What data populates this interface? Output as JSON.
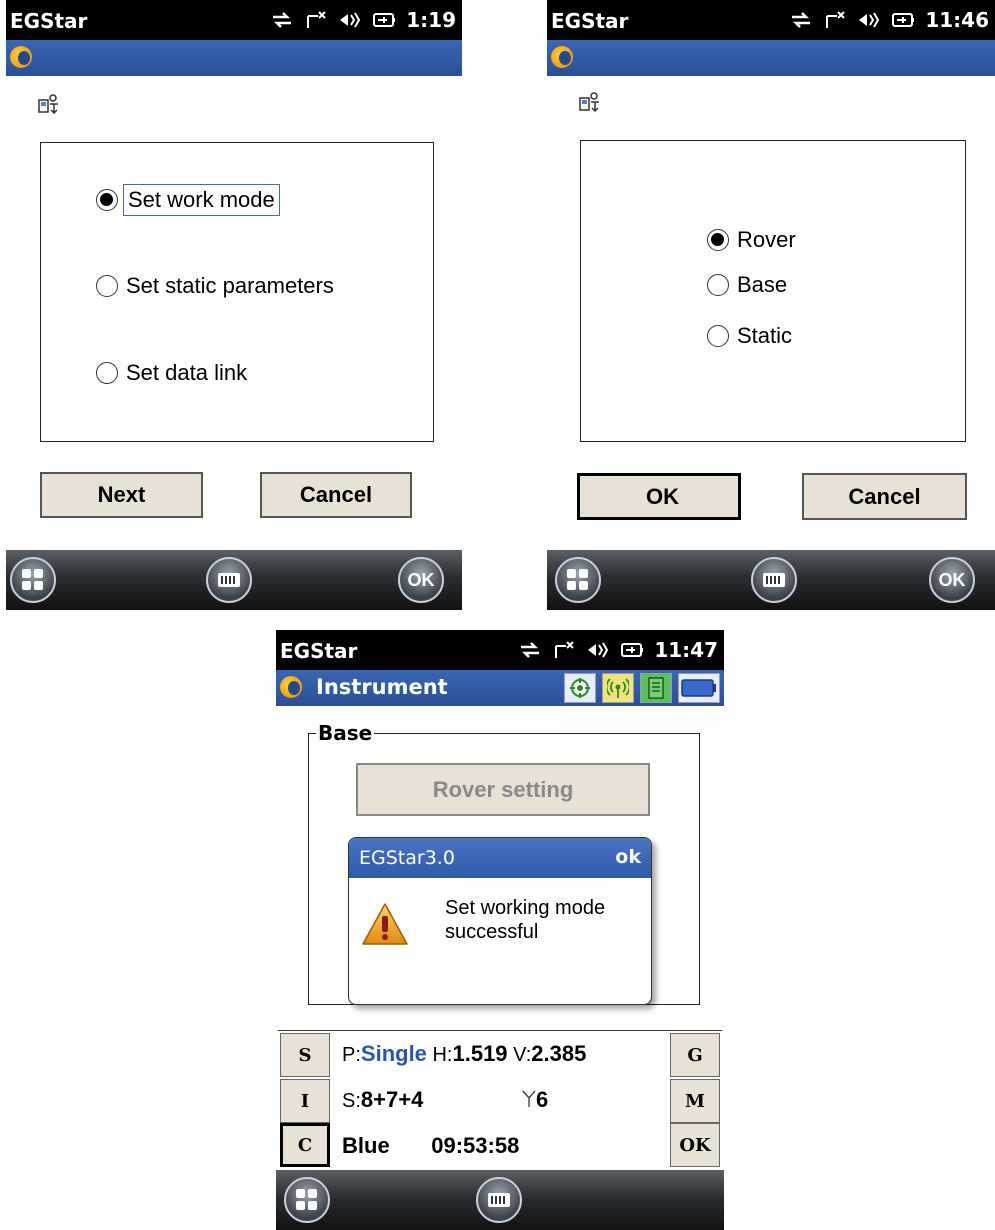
{
  "status": {
    "app": "EGStar",
    "times": [
      "1:19",
      "11:46",
      "11:47"
    ]
  },
  "screen1": {
    "options": [
      {
        "label": "Set work mode",
        "selected": true
      },
      {
        "label": "Set static parameters",
        "selected": false
      },
      {
        "label": "Set data link",
        "selected": false
      }
    ],
    "next_label": "Next",
    "cancel_label": "Cancel",
    "taskbar_ok": "OK"
  },
  "screen2": {
    "options": [
      {
        "label": "Rover",
        "selected": true
      },
      {
        "label": "Base",
        "selected": false
      },
      {
        "label": "Static",
        "selected": false
      }
    ],
    "ok_label": "OK",
    "cancel_label": "Cancel",
    "taskbar_ok": "OK"
  },
  "screen3": {
    "title": "Instrument",
    "group_label": "Base",
    "rover_setting_label": "Rover setting",
    "dialog": {
      "title": "EGStar3.0",
      "ok": "ok",
      "message_line1": "Set working mode",
      "message_line2": "successful"
    },
    "info": {
      "p_prefix": "P:",
      "p_value": "Single",
      "h_prefix": "H:",
      "h_value": "1.519",
      "v_prefix": "V:",
      "v_value": "2.385",
      "s_prefix": "S:",
      "s_value": "8+7+4",
      "sat_count": "6",
      "device": "Blue",
      "clock": "09:53:58"
    },
    "side_left": [
      "S",
      "I",
      "C"
    ],
    "side_right": [
      "G",
      "M",
      "OK"
    ]
  },
  "icons": [
    "sync-icon",
    "signal-off-icon",
    "volume-icon",
    "battery-icon",
    "wizard-icon",
    "windows-start-icon",
    "keyboard-icon",
    "warning-icon",
    "gps-target-icon",
    "radio-antenna-icon",
    "sim-card-icon",
    "battery-level-icon",
    "satellite-antenna-icon"
  ],
  "colors": {
    "titlebar": "#2a4f95",
    "accent_blue": "#2a56b0",
    "button_face": "#e8e2d6"
  }
}
